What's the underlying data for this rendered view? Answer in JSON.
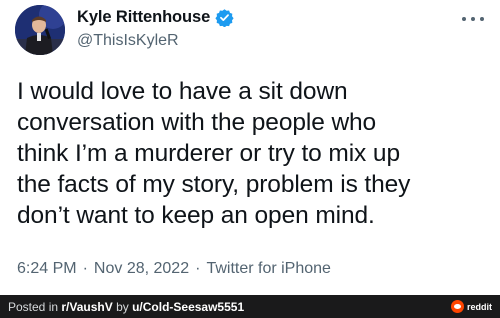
{
  "tweet": {
    "display_name": "Kyle Rittenhouse",
    "handle": "@ThisIsKyleR",
    "text": "I would love to have a sit down\nconversation with the people who\nthink I’m a murderer or try to mix up\nthe facts of my story, problem is they\ndon’t want to keep an open mind.",
    "time": "6:24 PM",
    "date": "Nov 28, 2022",
    "source": "Twitter for iPhone",
    "separator": "·"
  },
  "footer": {
    "prefix": "Posted in ",
    "subreddit": "r/VaushV",
    "by": " by ",
    "user": "u/Cold-Seesaw5551",
    "brand": "reddit"
  },
  "colors": {
    "text": "#0f1419",
    "secondary": "#536471",
    "verified": "#1d9bf0",
    "footer_bg": "#1a1a1b",
    "reddit": "#ff4500"
  },
  "icons": {
    "verified": "verified-badge-icon",
    "more": "more-options-icon",
    "reddit": "reddit-logo-icon"
  }
}
